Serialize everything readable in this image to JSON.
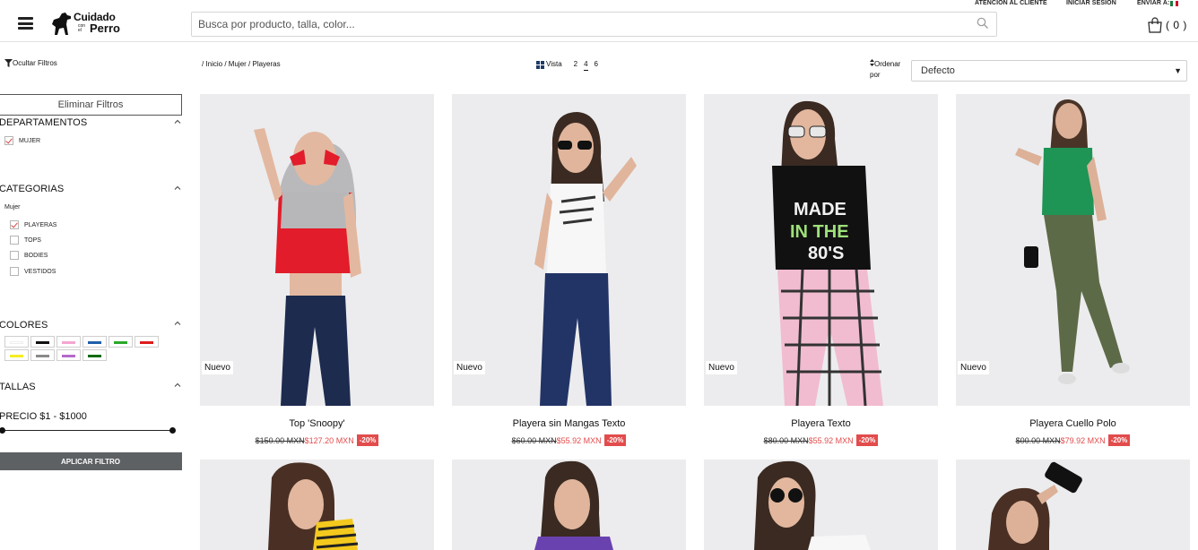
{
  "header": {
    "search_placeholder": "Busca por producto, talla, color...",
    "logo": {
      "line1": "Cuidado",
      "line2": "con el",
      "line3": "Perro"
    },
    "links": {
      "customer_service": "ATENCION AL CLIENTE",
      "login": "INICIAR SESION",
      "ship_to": "ENVIAR A:"
    },
    "cart_count": "( 0 )"
  },
  "sidebar": {
    "hide_filters": "Ocultar Filtros",
    "clear_filters": "Eliminar Filtros",
    "departments": {
      "title": "DEPARTAMENTOS",
      "items": [
        {
          "label": "MUJER",
          "checked": true
        }
      ]
    },
    "categories": {
      "title": "CATEGORIAS",
      "subtitle": "Mujer",
      "items": [
        {
          "label": "PLAYERAS",
          "checked": true
        },
        {
          "label": "TOPS",
          "checked": false
        },
        {
          "label": "BODIES",
          "checked": false
        },
        {
          "label": "VESTIDOS",
          "checked": false
        }
      ]
    },
    "colors": {
      "title": "COLORES",
      "swatches": [
        "#ffffff",
        "#111111",
        "#f4a6d0",
        "#1f5fa8",
        "#2aa82a",
        "#dd1c1c",
        "#f5ee22",
        "#8a8a8a",
        "#b469c9",
        "#136b13"
      ]
    },
    "sizes": {
      "title": "TALLAS"
    },
    "price": {
      "label": "PRECIO $1 - $1000",
      "min": 1,
      "max": 1000
    },
    "apply": "APLICAR FILTRO"
  },
  "toolbar": {
    "breadcrumb": [
      "/ Inicio",
      "/ Mujer",
      "/ Playeras"
    ],
    "view_label": "Vista",
    "view_options": [
      "2",
      "4",
      "6"
    ],
    "view_active": "4",
    "order_label": "Ordenar por",
    "order_value": "Defecto"
  },
  "products": [
    {
      "name": "Top 'Snoopy'",
      "old_price": "$150.00 MXN",
      "new_price": "$127.20 MXN",
      "discount": "-20%",
      "badge": "Nuevo"
    },
    {
      "name": "Playera sin Mangas Texto",
      "old_price": "$60.00 MXN",
      "new_price": "$55.92 MXN",
      "discount": "-20%",
      "badge": "Nuevo"
    },
    {
      "name": "Playera Texto",
      "old_price": "$80.00 MXN",
      "new_price": "$55.92 MXN",
      "discount": "-20%",
      "badge": "Nuevo"
    },
    {
      "name": "Playera Cuello Polo",
      "old_price": "$00.00 MXN",
      "new_price": "$79.92 MXN",
      "discount": "-20%",
      "badge": "Nuevo"
    }
  ],
  "colors": {
    "accent": "#e24c4c",
    "apply_bg": "#5e6164",
    "photo_bg": "#ececee"
  }
}
